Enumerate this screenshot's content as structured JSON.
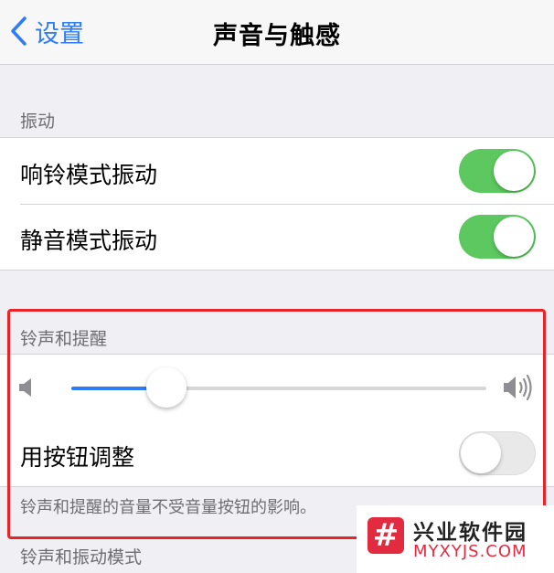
{
  "nav": {
    "back_label": "设置",
    "title": "声音与触感"
  },
  "vibrate_section": {
    "header": "振动",
    "rows": [
      {
        "label": "响铃模式振动",
        "toggle_on": true
      },
      {
        "label": "静音模式振动",
        "toggle_on": true
      }
    ]
  },
  "ringer_section": {
    "header": "铃声和提醒",
    "volume_level": 0.23,
    "adjust_row": {
      "label": "用按钮调整",
      "toggle_on": false
    },
    "footer": "铃声和提醒的音量不受音量按钮的影响。"
  },
  "next_section_header": "铃声和振动模式",
  "watermark": {
    "logo_char": "#",
    "title": "兴业软件园",
    "url": "MYXYJS.COM"
  },
  "colors": {
    "accent": "#2f7cf6",
    "toggle_on": "#5cc85f",
    "highlight": "#e8232a",
    "watermark": "#e32b40"
  },
  "icons": {
    "back": "chevron-left-icon",
    "volume_low": "speaker-low-icon",
    "volume_high": "speaker-high-icon"
  }
}
